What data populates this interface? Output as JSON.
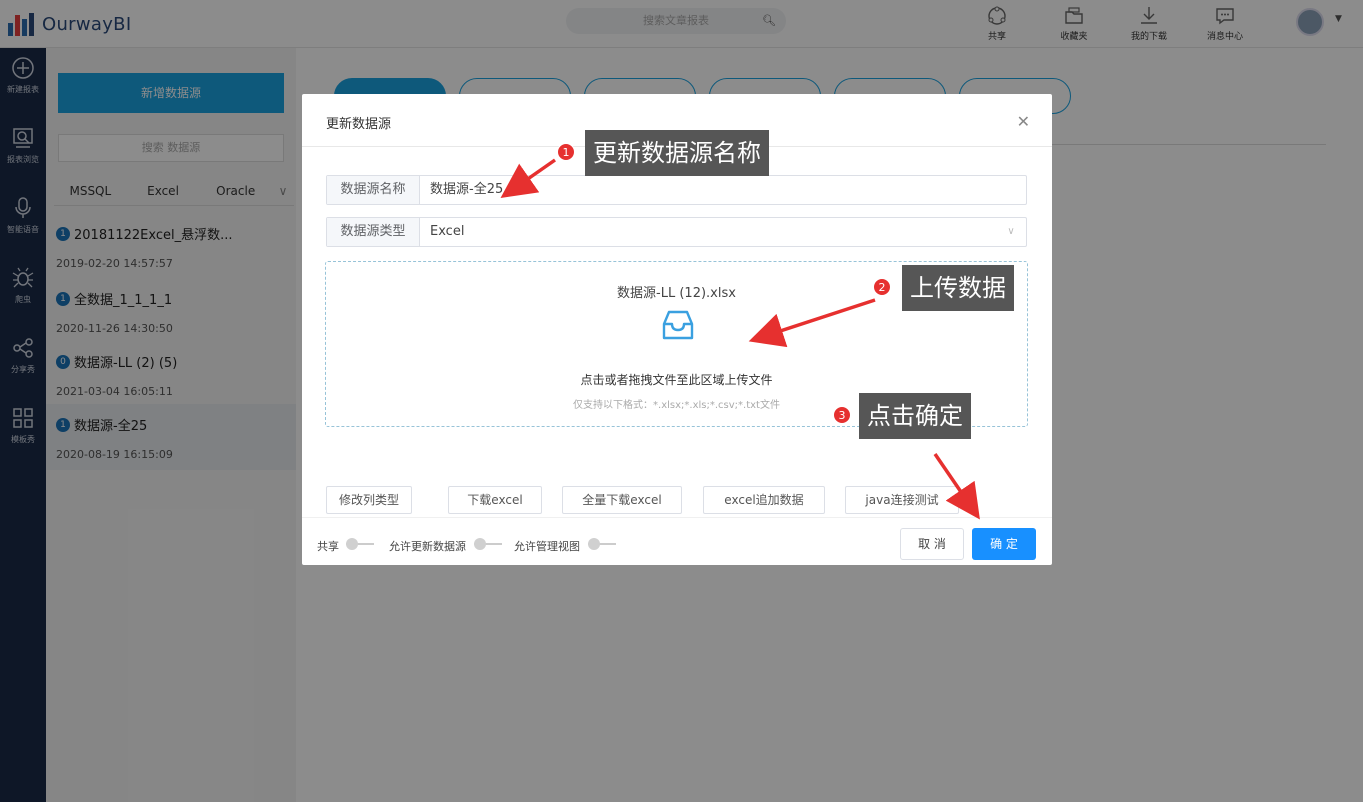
{
  "app": {
    "name": "OurwayBI"
  },
  "search": {
    "placeholder": "搜索文章报表"
  },
  "top_actions": [
    {
      "label": "共享",
      "icon": "share-icon"
    },
    {
      "label": "收藏夹",
      "icon": "folder-icon"
    },
    {
      "label": "我的下载",
      "icon": "download-icon"
    },
    {
      "label": "消息中心",
      "icon": "message-icon"
    }
  ],
  "left_nav": [
    {
      "label": "新建报表",
      "icon": "plus-circle-icon"
    },
    {
      "label": "报表浏览",
      "icon": "browse-icon"
    },
    {
      "label": "智能语音",
      "icon": "microphone-icon"
    },
    {
      "label": "爬虫",
      "icon": "spider-icon"
    },
    {
      "label": "分享秀",
      "icon": "share-nodes-icon"
    },
    {
      "label": "模板秀",
      "icon": "grid-icon"
    }
  ],
  "sidepanel": {
    "new_button": "新增数据源",
    "search_placeholder": "搜索 数据源",
    "tabs": [
      "MSSQL",
      "Excel",
      "Oracle"
    ],
    "items": [
      {
        "badge": "1",
        "name": "20181122Excel_悬浮数...",
        "time": "2019-02-20 14:57:57"
      },
      {
        "badge": "1",
        "name": "全数据_1_1_1_1",
        "time": "2020-11-26 14:30:50"
      },
      {
        "badge": "0",
        "name": "数据源-LL (2) (5)",
        "time": "2021-03-04 16:05:11"
      },
      {
        "badge": "1",
        "name": "数据源-全25",
        "time": "2020-08-19 16:15:09"
      }
    ]
  },
  "modal": {
    "title": "更新数据源",
    "name_label": "数据源名称",
    "name_value": "数据源-全25",
    "type_label": "数据源类型",
    "type_value": "Excel",
    "upload": {
      "file_name": "数据源-LL (12).xlsx",
      "text": "点击或者拖拽文件至此区域上传文件",
      "tip": "仅支持以下格式：*.xlsx;*.xls;*.csv;*.txt文件"
    },
    "actions": [
      "修改列类型",
      "下载excel",
      "全量下载excel",
      "excel追加数据",
      "java连接测试"
    ],
    "toggles": [
      "共享",
      "允许更新数据源",
      "允许管理视图"
    ],
    "cancel": "取 消",
    "ok": "确 定"
  },
  "callouts": [
    {
      "num": "1",
      "text": "更新数据源名称"
    },
    {
      "num": "2",
      "text": "上传数据"
    },
    {
      "num": "3",
      "text": "点击确定"
    }
  ],
  "colors": {
    "accent": "#1aa2e0",
    "primary": "#1890ff",
    "nav_bg": "#1a2b47",
    "callout_bg": "#565656",
    "badge_red": "#e6302f"
  }
}
